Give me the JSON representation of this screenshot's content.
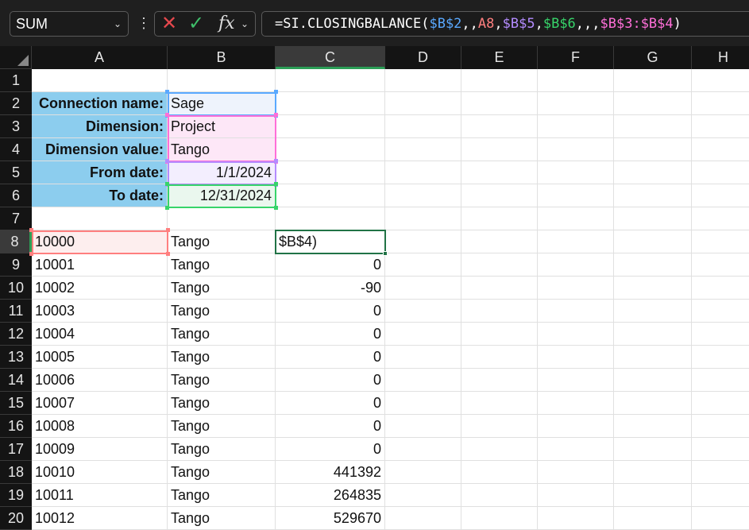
{
  "toolbar": {
    "name_box": "SUM",
    "cancel_icon": "x-icon",
    "enter_icon": "check-icon",
    "function_icon": "fx-icon",
    "formula_parts": [
      {
        "text": "=SI.CLOSINGBALANCE(",
        "color": "#ffffff"
      },
      {
        "text": "$B$2",
        "color": "#5aa9ff"
      },
      {
        "text": ",,",
        "color": "#ffffff"
      },
      {
        "text": "A8",
        "color": "#ff7f7f"
      },
      {
        "text": ",",
        "color": "#ffffff"
      },
      {
        "text": "$B$5",
        "color": "#b48cff"
      },
      {
        "text": ",",
        "color": "#ffffff"
      },
      {
        "text": "$B$6",
        "color": "#37d46a"
      },
      {
        "text": ",,,",
        "color": "#ffffff"
      },
      {
        "text": "$B$3:$B$4",
        "color": "#ff6fd8"
      },
      {
        "text": ")",
        "color": "#ffffff"
      }
    ]
  },
  "columns": [
    "A",
    "B",
    "C",
    "D",
    "E",
    "F",
    "G",
    "H"
  ],
  "rows": [
    "1",
    "2",
    "3",
    "4",
    "5",
    "6",
    "7",
    "8",
    "9",
    "10",
    "11",
    "12",
    "13",
    "14",
    "15",
    "16",
    "17",
    "18",
    "19",
    "20"
  ],
  "params": [
    {
      "label": "Connection name:",
      "value": "Sage"
    },
    {
      "label": "Dimension:",
      "value": "Project"
    },
    {
      "label": "Dimension value:",
      "value": "Tango"
    },
    {
      "label": "From date:",
      "value": "1/1/2024"
    },
    {
      "label": "To date:",
      "value": "12/31/2024"
    }
  ],
  "data_rows": [
    {
      "account": "10000",
      "project": "Tango",
      "balance": "$B$4)"
    },
    {
      "account": "10001",
      "project": "Tango",
      "balance": "0"
    },
    {
      "account": "10002",
      "project": "Tango",
      "balance": "-90"
    },
    {
      "account": "10003",
      "project": "Tango",
      "balance": "0"
    },
    {
      "account": "10004",
      "project": "Tango",
      "balance": "0"
    },
    {
      "account": "10005",
      "project": "Tango",
      "balance": "0"
    },
    {
      "account": "10006",
      "project": "Tango",
      "balance": "0"
    },
    {
      "account": "10007",
      "project": "Tango",
      "balance": "0"
    },
    {
      "account": "10008",
      "project": "Tango",
      "balance": "0"
    },
    {
      "account": "10009",
      "project": "Tango",
      "balance": "0"
    },
    {
      "account": "10010",
      "project": "Tango",
      "balance": "441392"
    },
    {
      "account": "10011",
      "project": "Tango",
      "balance": "264835"
    },
    {
      "account": "10012",
      "project": "Tango",
      "balance": "529670"
    }
  ],
  "colors": {
    "label_fill": "#8ccdee",
    "ref_b2": "#5aa9ff",
    "ref_a8": "#ff7f7f",
    "ref_b5": "#b48cff",
    "ref_b6": "#37d46a",
    "ref_b3_b4": "#ff6fd8",
    "active_cell": "#217346"
  }
}
